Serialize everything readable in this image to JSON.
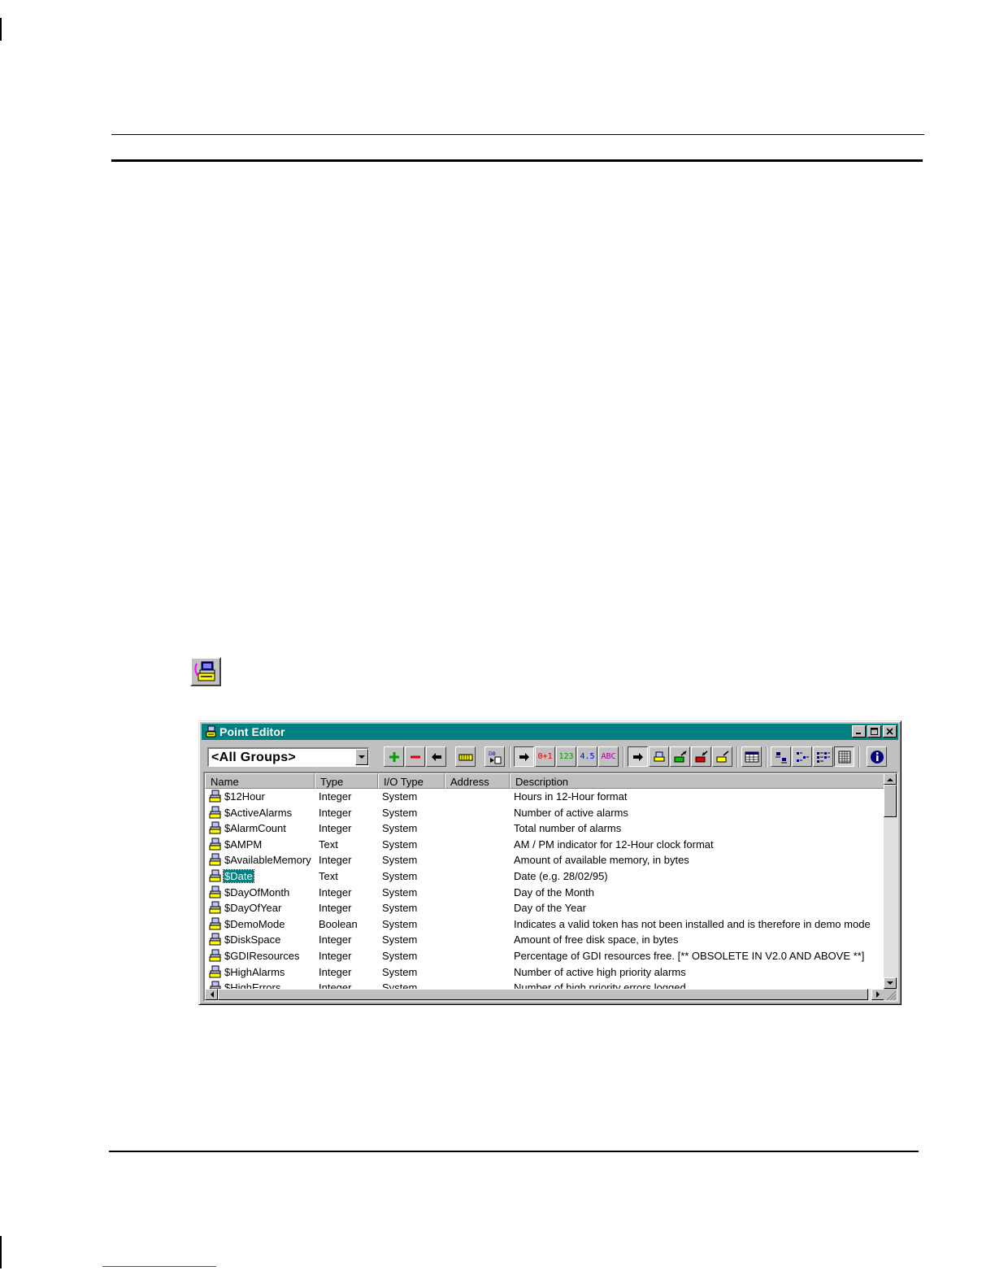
{
  "window": {
    "title": "Point Editor"
  },
  "toolbar": {
    "group_select_value": "<All Groups>",
    "type_labels": [
      "0+1",
      "123",
      "4.5",
      "ABC"
    ]
  },
  "list": {
    "columns": [
      "Name",
      "Type",
      "I/O Type",
      "Address",
      "Description"
    ],
    "rows": [
      {
        "name": "$12Hour",
        "type": "Integer",
        "io": "System",
        "address": "",
        "desc": "Hours in 12-Hour format"
      },
      {
        "name": "$ActiveAlarms",
        "type": "Integer",
        "io": "System",
        "address": "",
        "desc": "Number of active alarms"
      },
      {
        "name": "$AlarmCount",
        "type": "Integer",
        "io": "System",
        "address": "",
        "desc": "Total number of alarms"
      },
      {
        "name": "$AMPM",
        "type": "Text",
        "io": "System",
        "address": "",
        "desc": "AM / PM indicator for 12-Hour clock format"
      },
      {
        "name": "$AvailableMemory",
        "type": "Integer",
        "io": "System",
        "address": "",
        "desc": "Amount of available memory, in bytes"
      },
      {
        "name": "$Date",
        "type": "Text",
        "io": "System",
        "address": "",
        "desc": "Date (e.g. 28/02/95)"
      },
      {
        "name": "$DayOfMonth",
        "type": "Integer",
        "io": "System",
        "address": "",
        "desc": "Day of the Month"
      },
      {
        "name": "$DayOfYear",
        "type": "Integer",
        "io": "System",
        "address": "",
        "desc": "Day of the Year"
      },
      {
        "name": "$DemoMode",
        "type": "Boolean",
        "io": "System",
        "address": "",
        "desc": "Indicates a valid token has not been installed and is therefore in demo mode"
      },
      {
        "name": "$DiskSpace",
        "type": "Integer",
        "io": "System",
        "address": "",
        "desc": "Amount of free disk space, in bytes"
      },
      {
        "name": "$GDIResources",
        "type": "Integer",
        "io": "System",
        "address": "",
        "desc": "Percentage of GDI resources free.  [** OBSOLETE  IN  V2.0  AND  ABOVE **]"
      },
      {
        "name": "$HighAlarms",
        "type": "Integer",
        "io": "System",
        "address": "",
        "desc": "Number of active high priority alarms"
      },
      {
        "name": "$HighErrors",
        "type": "Integer",
        "io": "System",
        "address": "",
        "desc": "Number of high priority errors logged"
      }
    ],
    "selected_index": 5
  },
  "colors": {
    "titlebar": "#008080",
    "selection": "#008080",
    "face": "#c0c0c0"
  },
  "icons": {
    "standalone": "point-editor-icon",
    "row": "point-icon"
  }
}
